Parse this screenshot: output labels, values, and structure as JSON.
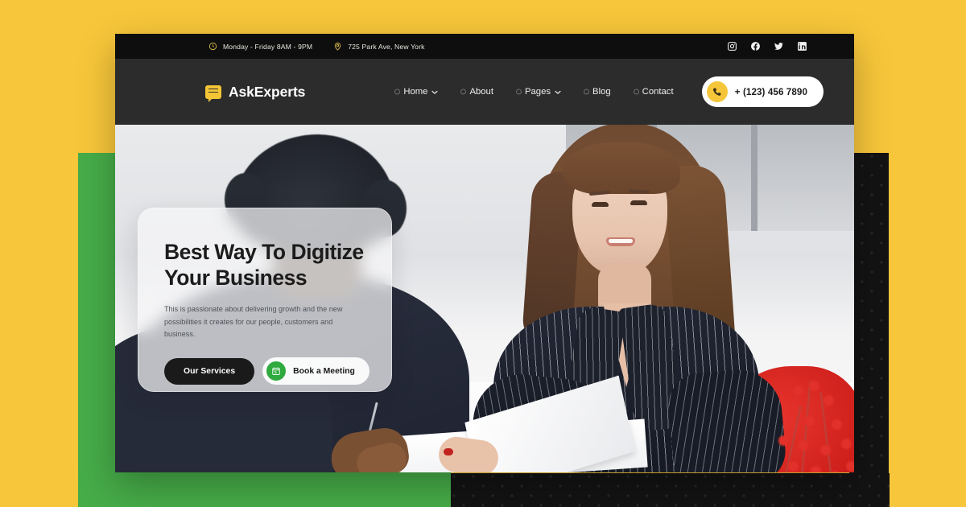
{
  "site": {
    "brand_name": "AskExperts",
    "brand_icon": "chat-bubble-icon"
  },
  "topbar": {
    "hours": "Monday - Friday 8AM - 9PM",
    "hours_icon": "clock-icon",
    "address": "725 Park Ave, New York",
    "address_icon": "location-pin-icon",
    "socials": [
      {
        "name": "instagram-icon",
        "label": "Instagram"
      },
      {
        "name": "facebook-icon",
        "label": "Facebook"
      },
      {
        "name": "twitter-icon",
        "label": "Twitter"
      },
      {
        "name": "linkedin-icon",
        "label": "LinkedIn"
      }
    ]
  },
  "nav": {
    "items": [
      {
        "label": "Home",
        "has_dropdown": true
      },
      {
        "label": "About",
        "has_dropdown": false
      },
      {
        "label": "Pages",
        "has_dropdown": true
      },
      {
        "label": "Blog",
        "has_dropdown": false
      },
      {
        "label": "Contact",
        "has_dropdown": false
      }
    ],
    "phone": "+ (123) 456 7890",
    "phone_icon": "phone-icon"
  },
  "hero": {
    "title": "Best Way To Digitize Your Business",
    "description": "This is passionate about delivering growth and the new possibilities it creates for our people, customers and business.",
    "primary_cta": "Our Services",
    "secondary_cta": "Book a Meeting",
    "secondary_cta_icon": "calendar-icon"
  },
  "colors": {
    "page_background": "#f7c63a",
    "accent_green": "#46ac48",
    "accent_dark": "#131313",
    "brand_yellow": "#f3c536",
    "nav_bar": "#2c2c2c",
    "top_bar": "#0e0e0e",
    "cta_green": "#2eaa3f"
  }
}
